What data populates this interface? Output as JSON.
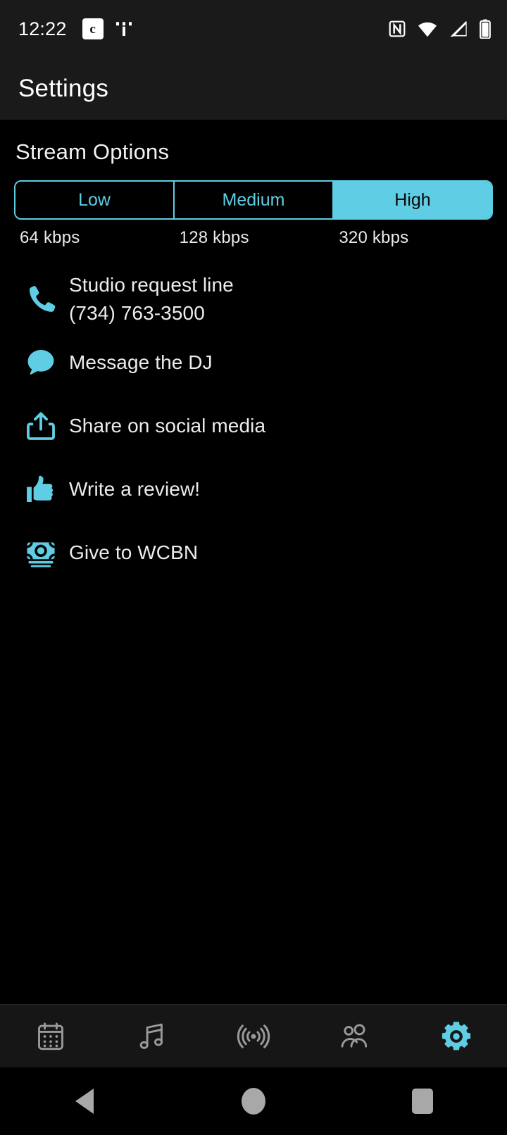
{
  "status_bar": {
    "time": "12:22",
    "left_icons": [
      {
        "name": "carrier-c-badge-icon",
        "glyph": "c"
      },
      {
        "name": "t-mobile-logo-icon"
      }
    ],
    "right_icons": [
      {
        "name": "nfc-icon"
      },
      {
        "name": "wifi-icon"
      },
      {
        "name": "cellular-signal-icon"
      },
      {
        "name": "battery-icon"
      }
    ]
  },
  "app_bar": {
    "title": "Settings"
  },
  "stream_options": {
    "section_title": "Stream Options",
    "selected": "High",
    "segments": [
      {
        "label": "Low",
        "bitrate": "64 kbps",
        "selected": false
      },
      {
        "label": "Medium",
        "bitrate": "128 kbps",
        "selected": false
      },
      {
        "label": "High",
        "bitrate": "320 kbps",
        "selected": true
      }
    ]
  },
  "actions": [
    {
      "icon": "phone-icon",
      "label": "Studio request line",
      "sublabel": "(734) 763-3500"
    },
    {
      "icon": "chat-bubble-icon",
      "label": "Message the DJ",
      "sublabel": ""
    },
    {
      "icon": "share-icon",
      "label": "Share on social media",
      "sublabel": ""
    },
    {
      "icon": "thumbs-up-icon",
      "label": "Write a review!",
      "sublabel": ""
    },
    {
      "icon": "money-banknote-icon",
      "label": "Give to WCBN",
      "sublabel": ""
    }
  ],
  "bottom_nav": [
    {
      "name": "tab-schedule",
      "icon": "calendar-icon",
      "active": false
    },
    {
      "name": "tab-playlist",
      "icon": "music-note-icon",
      "active": false
    },
    {
      "name": "tab-live",
      "icon": "broadcast-icon",
      "active": false
    },
    {
      "name": "tab-djs",
      "icon": "people-icon",
      "active": false
    },
    {
      "name": "tab-settings",
      "icon": "gear-icon",
      "active": true
    }
  ],
  "system_nav": [
    {
      "name": "android-back-button"
    },
    {
      "name": "android-home-button"
    },
    {
      "name": "android-recents-button"
    }
  ],
  "colors": {
    "accent": "#5fcde4",
    "background": "#000000",
    "surface": "#1a1a1a",
    "nav_surface": "#161616",
    "text_primary": "#ececec",
    "text_inverse": "#0a0a0a",
    "nav_inactive": "#9a9a9a"
  }
}
